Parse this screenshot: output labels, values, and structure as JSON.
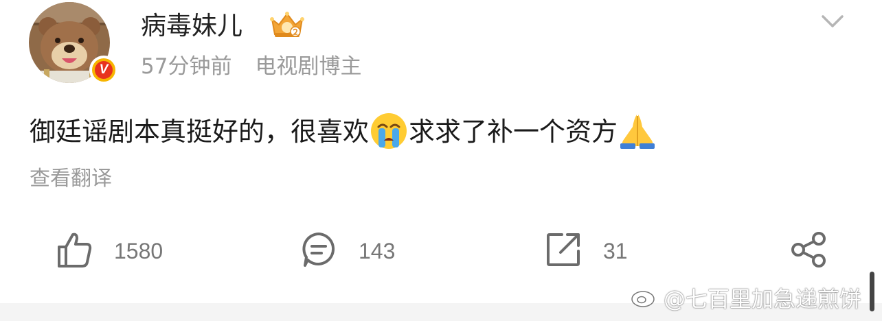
{
  "post": {
    "username": "病毒妹儿",
    "time": "57分钟前",
    "tag": "电视剧博主",
    "verified_mark": "V",
    "text_part1": "御廷谣剧本真挺好的，很喜欢",
    "emoji1": "crying-face",
    "text_part2": "求求了补一个资方",
    "emoji2": "praying-hands",
    "translate_label": "查看翻译"
  },
  "actions": {
    "like_count": "1580",
    "comment_count": "143",
    "repost_count": "31"
  },
  "watermark": "@七百里加急递煎饼",
  "colors": {
    "text": "#1a1a1a",
    "muted": "#9a9a9a",
    "verified_red": "#e8331e",
    "verified_gold": "#f7b500",
    "icon_gray": "#6b6b6b"
  }
}
